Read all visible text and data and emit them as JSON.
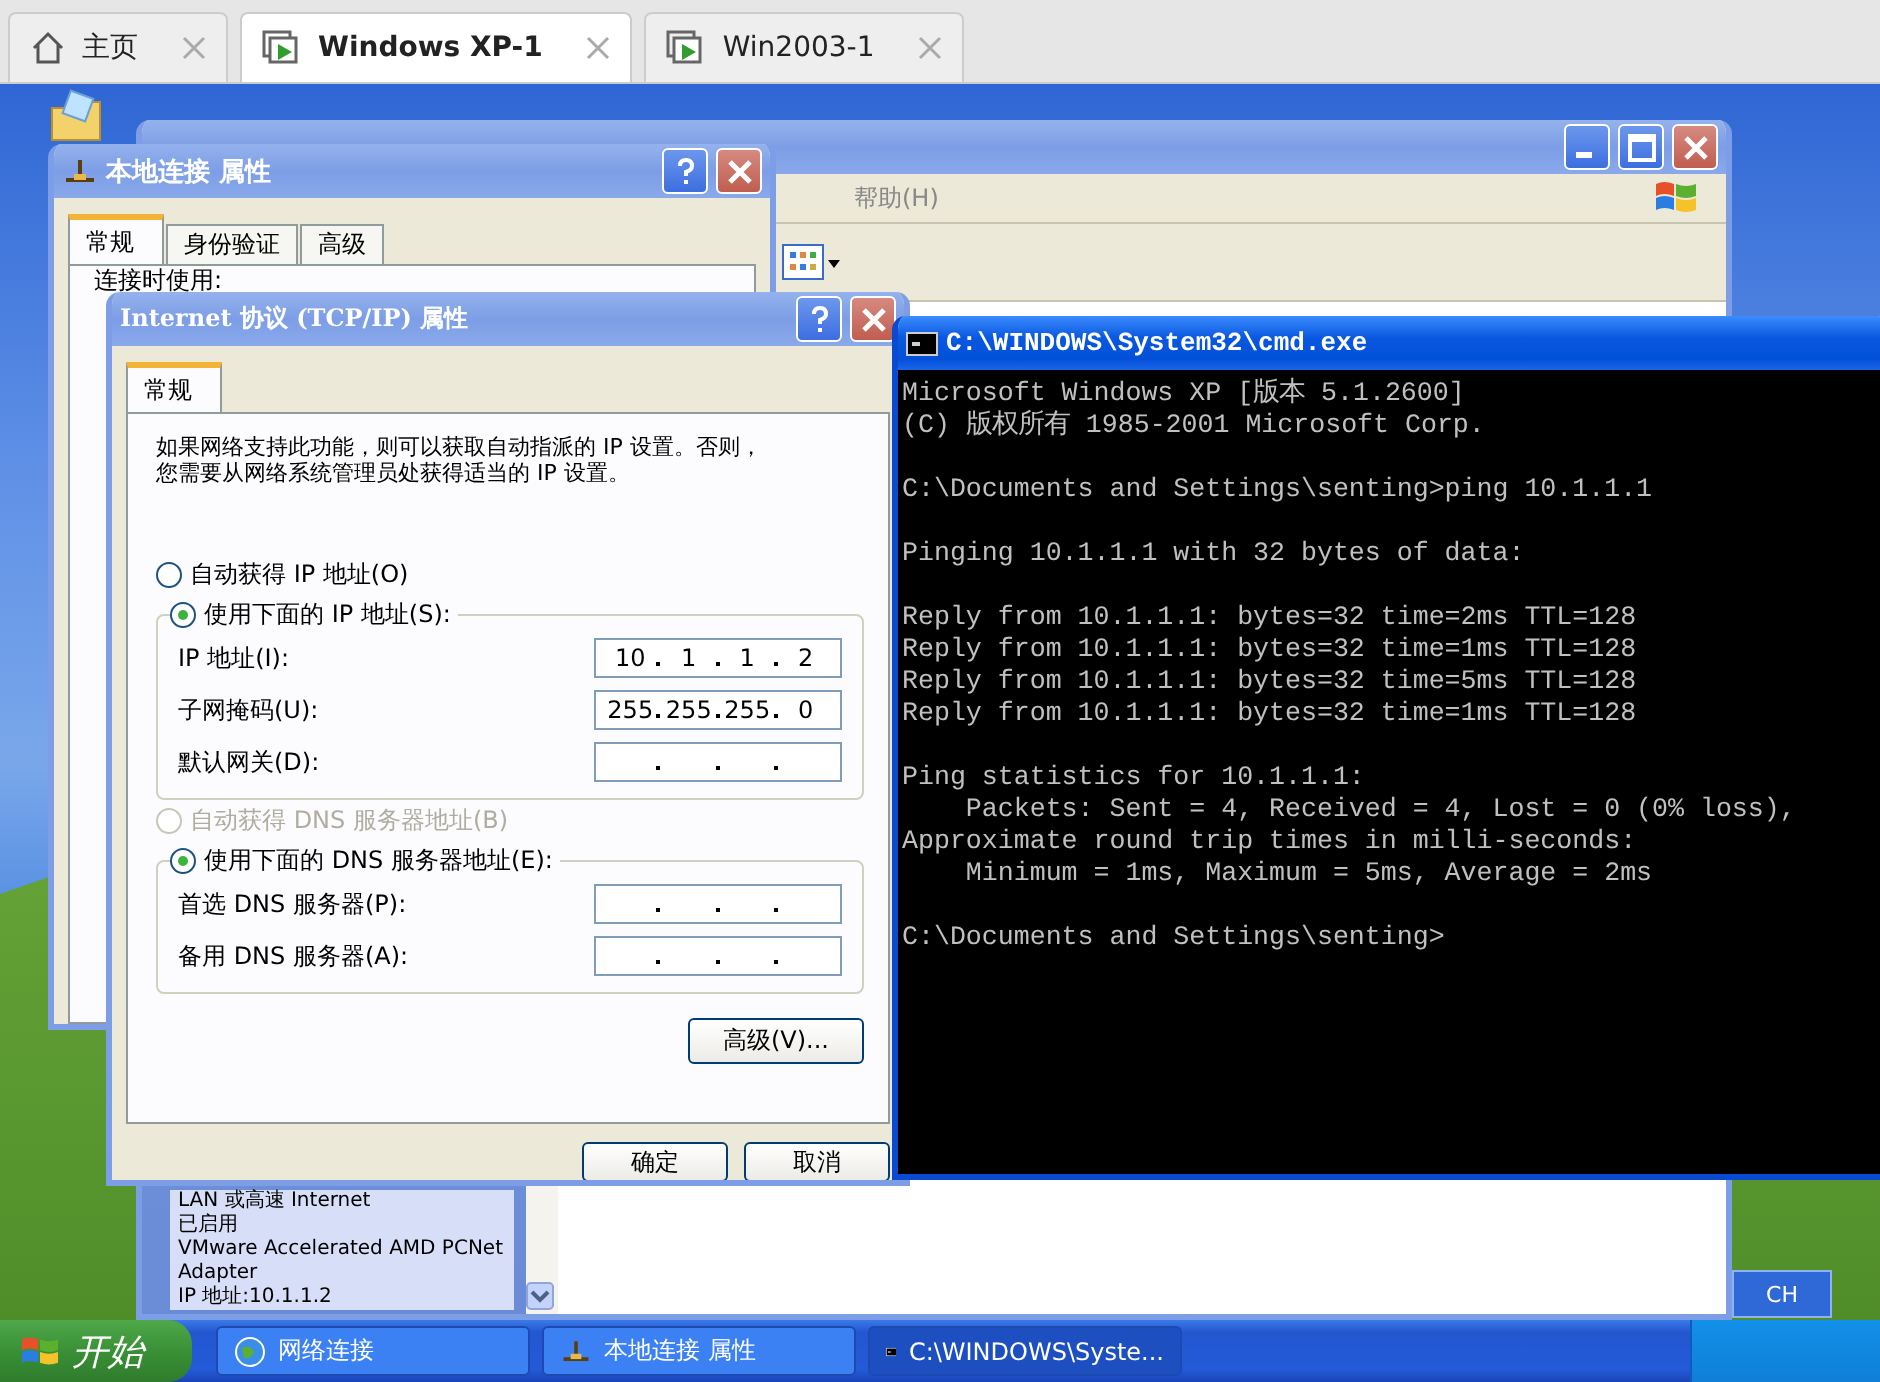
{
  "browser_tabs": [
    {
      "kind": "home",
      "label": "主页",
      "selected": false
    },
    {
      "kind": "vm",
      "label": "Windows XP-1",
      "selected": true
    },
    {
      "kind": "vm",
      "label": "Win2003-1",
      "selected": false
    }
  ],
  "network_window": {
    "active": false,
    "menu": [
      "帮助(H)"
    ],
    "details": [
      "LAN 或高速 Internet",
      "已启用",
      "VMware Accelerated AMD PCNet Adapter",
      "IP 地址:10.1.1.2"
    ]
  },
  "local_dialog": {
    "title": "本地连接 属性",
    "active": false,
    "tabs": [
      {
        "label": "常规",
        "selected": true
      },
      {
        "label": "身份验证",
        "selected": false
      },
      {
        "label": "高级",
        "selected": false
      }
    ],
    "connect_label": "连接时使用:"
  },
  "tcp_dialog": {
    "title": "Internet 协议 (TCP/IP) 属性",
    "active": false,
    "tabs": [
      {
        "label": "常规",
        "selected": true
      }
    ],
    "description": "如果网络支持此功能，则可以获取自动指派的 IP 设置。否则，您需要从网络系统管理员处获得适当的 IP 设置。",
    "ip_options": [
      {
        "label": "自动获得 IP 地址(O)",
        "selected": false,
        "disabled": false
      },
      {
        "label": "使用下面的 IP 地址(S):",
        "selected": true,
        "disabled": false
      }
    ],
    "ip_fields": [
      {
        "label": "IP 地址(I):",
        "octets": [
          "10",
          "1",
          "1",
          "2"
        ]
      },
      {
        "label": "子网掩码(U):",
        "octets": [
          "255",
          "255",
          "255",
          "0"
        ]
      },
      {
        "label": "默认网关(D):"
      }
    ],
    "dns_options": [
      {
        "label": "自动获得 DNS 服务器地址(B)",
        "selected": false,
        "disabled": true
      },
      {
        "label": "使用下面的 DNS 服务器地址(E):",
        "selected": true,
        "disabled": false
      }
    ],
    "dns_fields": [
      {
        "label": "首选 DNS 服务器(P):"
      },
      {
        "label": "备用 DNS 服务器(A):"
      }
    ],
    "advanced_button": "高级(V)...",
    "buttons": [
      "确定",
      "取消"
    ]
  },
  "cmd": {
    "title": "C:\\WINDOWS\\System32\\cmd.exe",
    "active": true,
    "blocks": [
      [
        "Microsoft Windows XP [版本 5.1.2600]",
        "(C) 版权所有 1985-2001 Microsoft Corp."
      ],
      [
        "C:\\Documents and Settings\\senting>ping 10.1.1.1"
      ],
      [
        "Pinging 10.1.1.1 with 32 bytes of data:"
      ],
      [
        "Reply from 10.1.1.1: bytes=32 time=2ms TTL=128",
        "Reply from 10.1.1.1: bytes=32 time=1ms TTL=128",
        "Reply from 10.1.1.1: bytes=32 time=5ms TTL=128",
        "Reply from 10.1.1.1: bytes=32 time=1ms TTL=128"
      ],
      [
        "Ping statistics for 10.1.1.1:",
        "    Packets: Sent = 4, Received = 4, Lost = 0 (0% loss),",
        "Approximate round trip times in milli-seconds:",
        "    Minimum = 1ms, Maximum = 5ms, Average = 2ms"
      ],
      [
        "C:\\Documents and Settings\\senting>"
      ]
    ]
  },
  "taskbar": {
    "start": "开始",
    "tasks": [
      {
        "kind": "network",
        "label": "网络连接",
        "selected": false
      },
      {
        "kind": "dialog",
        "label": "本地连接 属性",
        "selected": false
      },
      {
        "kind": "cmd",
        "label": "C:\\WINDOWS\\Syste...",
        "selected": true
      }
    ],
    "language": "CH"
  }
}
